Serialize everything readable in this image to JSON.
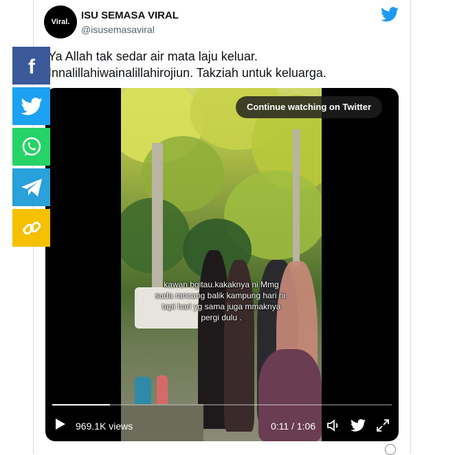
{
  "tweet": {
    "avatar_text": "Viral.",
    "author_name": "ISU SEMASA VIRAL",
    "author_handle": "@isusemasaviral",
    "text": "Ya Allah tak sedar air mata laju keluar.\nInnalillahiwainalillahirojiun. Takziah untuk keluarga."
  },
  "video": {
    "continue_label": "Continue watching on Twitter",
    "caption": "kawan bgitau.kakaknya ni Mmg\nsuda rancang balik kampung hari ni.\ntapi hari yg sama juga mmaknya\npergi dulu .",
    "views": "969.1K views",
    "time": "0:11 / 1:06",
    "progress": 0.17
  },
  "share_buttons": [
    {
      "name": "facebook",
      "color": "#3b5998",
      "icon": "facebook-icon"
    },
    {
      "name": "twitter",
      "color": "#1da1f2",
      "icon": "twitter-icon"
    },
    {
      "name": "whatsapp",
      "color": "#25d366",
      "icon": "whatsapp-icon"
    },
    {
      "name": "telegram",
      "color": "#2aa1da",
      "icon": "telegram-icon"
    },
    {
      "name": "copy-link",
      "color": "#f5c000",
      "icon": "link-icon"
    }
  ],
  "colors": {
    "twitter_blue": "#1d9bf0",
    "handle_gray": "#536471"
  }
}
